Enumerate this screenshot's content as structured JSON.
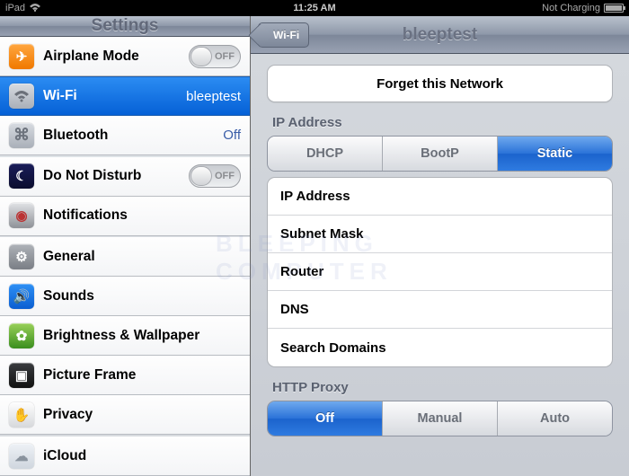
{
  "statusbar": {
    "device": "iPad",
    "time": "11:25 AM",
    "charge_text": "Not Charging"
  },
  "left": {
    "title": "Settings",
    "items": [
      {
        "label": "Airplane Mode",
        "right": "",
        "toggle": true,
        "toggle_text": "OFF"
      },
      {
        "label": "Wi-Fi",
        "right": "bleeptest",
        "selected": true
      },
      {
        "label": "Bluetooth",
        "right": "Off"
      }
    ],
    "items2": [
      {
        "label": "Do Not Disturb",
        "toggle": true,
        "toggle_text": "OFF"
      },
      {
        "label": "Notifications"
      }
    ],
    "items3": [
      {
        "label": "General"
      },
      {
        "label": "Sounds"
      },
      {
        "label": "Brightness & Wallpaper"
      },
      {
        "label": "Picture Frame"
      },
      {
        "label": "Privacy"
      }
    ],
    "items4": [
      {
        "label": "iCloud"
      }
    ]
  },
  "right": {
    "back_label": "Wi-Fi",
    "title": "bleeptest",
    "forget_button": "Forget this Network",
    "ip_header": "IP Address",
    "ip_seg": [
      "DHCP",
      "BootP",
      "Static"
    ],
    "ip_seg_active": 2,
    "fields": [
      "IP Address",
      "Subnet Mask",
      "Router",
      "DNS",
      "Search Domains"
    ],
    "proxy_header": "HTTP Proxy",
    "proxy_seg": [
      "Off",
      "Manual",
      "Auto"
    ],
    "proxy_seg_active": 0
  },
  "watermark": "BLEEPING\nCOMPUTER"
}
